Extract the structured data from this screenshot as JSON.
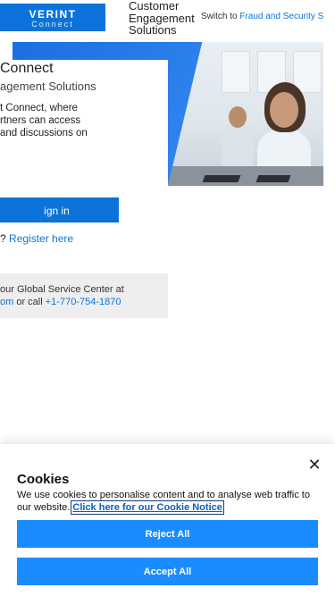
{
  "header": {
    "logo_line1": "VERINT",
    "logo_line2": "Connect",
    "brand_line1": "Customer",
    "brand_line2": "Engagement",
    "brand_line3": "Solutions",
    "switch_prefix": "Switch to",
    "switch_link": "Fraud and Security S"
  },
  "hero": {
    "title": "Connect",
    "subtitle": "agement Solutions",
    "body_lines": [
      "t Connect, where",
      "rtners can access",
      "and discussions on"
    ]
  },
  "actions": {
    "signin_label": "ign in",
    "register_prefix": "?",
    "register_link": "Register here"
  },
  "support": {
    "line1": "our Global Service Center at",
    "email_fragment": "om",
    "middle": "or call",
    "phone": "+1-770-754-1870"
  },
  "cookie": {
    "title": "Cookies",
    "description": "We use cookies to personalise content and to analyse web traffic to our website.",
    "notice_link": "Click here for our Cookie Notice",
    "reject_label": "Reject All",
    "accept_label": "Accept All",
    "close_glyph": "✕"
  },
  "colors": {
    "brand_blue": "#0b73d9",
    "button_blue": "#1a8cff"
  }
}
